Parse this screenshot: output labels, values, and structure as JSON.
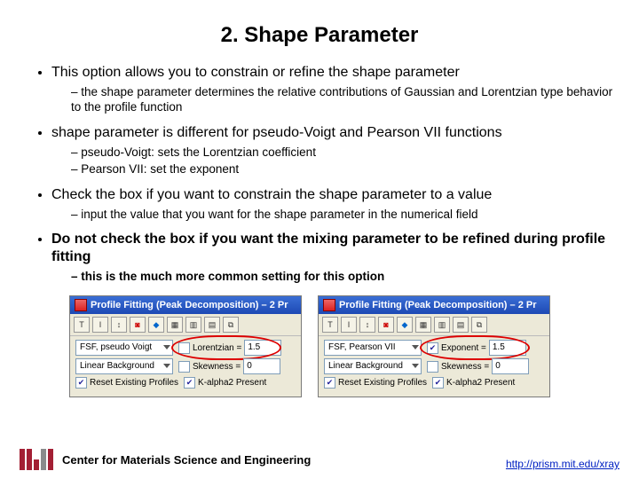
{
  "title": "2. Shape Parameter",
  "bullets": {
    "b1": "This option allows you to constrain or refine the shape parameter",
    "b1s1": "the shape parameter determines the relative contributions of Gaussian and Lorentzian type behavior to the profile function",
    "b2": "shape parameter is different for pseudo-Voigt and Pearson VII functions",
    "b2s1": "pseudo-Voigt: sets the Lorentzian coefficient",
    "b2s2": "Pearson VII: set the exponent",
    "b3": "Check the box if you want to constrain the shape parameter to a value",
    "b3s1": "input the value that you want for the shape parameter in the numerical field",
    "b4": "Do not check the box if you want the mixing parameter to be refined during profile fitting",
    "b4s1": "this is the much more common setting for this option"
  },
  "winA": {
    "title": "Profile Fitting (Peak Decomposition) – 2 Pr",
    "fsf": "FSF, pseudo Voigt",
    "lorentzian_label": "Lorentzian =",
    "lorentzian_val": "1.5",
    "bg": "Linear Background",
    "skew_label": "Skewness =",
    "skew_val": "0",
    "chk1": "Reset Existing Profiles",
    "chk2": "K-alpha2 Present"
  },
  "winB": {
    "title": "Profile Fitting (Peak Decomposition) – 2 Pr",
    "fsf": "FSF, Pearson VII",
    "exp_label": "Exponent =",
    "exp_val": "1.5",
    "bg": "Linear Background",
    "skew_label": "Skewness =",
    "skew_val": "0",
    "chk1": "Reset Existing Profiles",
    "chk2": "K-alpha2 Present"
  },
  "footer": {
    "center": "Center for Materials Science and Engineering",
    "url": "http://prism.mit.edu/xray"
  }
}
